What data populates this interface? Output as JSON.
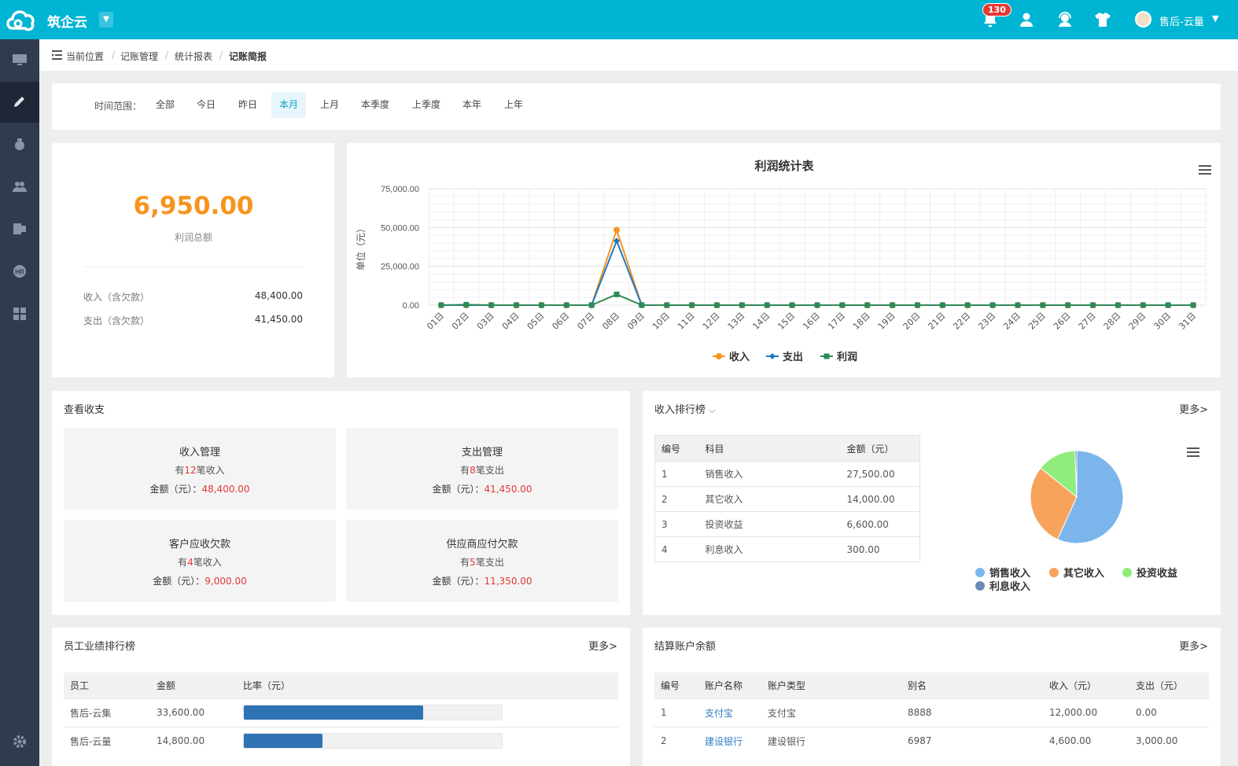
{
  "app": {
    "brand": "筑企云",
    "notif_count": "130",
    "user": "售后-云量"
  },
  "breadcrumb": {
    "prefix": "当前位置",
    "items": [
      "记账管理",
      "统计报表",
      "记账简报"
    ]
  },
  "filter": {
    "label": "时间范围：",
    "options": [
      "全部",
      "今日",
      "昨日",
      "本月",
      "上月",
      "本季度",
      "上季度",
      "本年",
      "上年"
    ],
    "active": "本月"
  },
  "summary": {
    "profit": "6,950.00",
    "profit_label": "利润总额",
    "income_label": "收入（含欠款）",
    "income": "48,400.00",
    "expense_label": "支出（含欠款）",
    "expense": "41,450.00"
  },
  "chart_data": {
    "type": "line",
    "title": "利润统计表",
    "ylabel": "单位（元）",
    "ylim": [
      0,
      75000
    ],
    "yticks": [
      "0.00",
      "25,000.00",
      "50,000.00",
      "75,000.00"
    ],
    "categories": [
      "01日",
      "02日",
      "03日",
      "04日",
      "05日",
      "06日",
      "07日",
      "08日",
      "09日",
      "10日",
      "11日",
      "12日",
      "13日",
      "14日",
      "15日",
      "16日",
      "17日",
      "18日",
      "19日",
      "20日",
      "21日",
      "22日",
      "23日",
      "24日",
      "25日",
      "26日",
      "27日",
      "28日",
      "29日",
      "30日",
      "31日"
    ],
    "series": [
      {
        "name": "收入",
        "color": "#f7941d",
        "marker": "circle",
        "values": [
          0,
          0,
          0,
          0,
          0,
          0,
          0,
          48400,
          0,
          0,
          0,
          0,
          0,
          0,
          0,
          0,
          0,
          0,
          0,
          0,
          0,
          0,
          0,
          0,
          0,
          0,
          0,
          0,
          0,
          0,
          0
        ]
      },
      {
        "name": "支出",
        "color": "#1f7ac2",
        "marker": "diamond",
        "values": [
          0,
          0,
          0,
          0,
          0,
          0,
          0,
          41450,
          0,
          0,
          0,
          0,
          0,
          0,
          0,
          0,
          0,
          0,
          0,
          0,
          0,
          0,
          0,
          0,
          0,
          0,
          0,
          0,
          0,
          0,
          0
        ]
      },
      {
        "name": "利润",
        "color": "#2e8b57",
        "marker": "square",
        "values": [
          0,
          300,
          0,
          0,
          0,
          0,
          0,
          6950,
          0,
          0,
          0,
          0,
          0,
          0,
          0,
          0,
          0,
          0,
          0,
          0,
          0,
          0,
          0,
          0,
          0,
          0,
          0,
          0,
          0,
          0,
          0
        ]
      }
    ],
    "legend": "bottom-center",
    "grid": true
  },
  "view": {
    "title": "查看收支",
    "tiles": [
      {
        "title": "收入管理",
        "pre": "有",
        "count": "12",
        "post": "笔收入",
        "amount_label": "金额（元）：",
        "amount": "48,400.00"
      },
      {
        "title": "支出管理",
        "pre": "有",
        "count": "8",
        "post": "笔支出",
        "amount_label": "金额（元）：",
        "amount": "41,450.00"
      },
      {
        "title": "客户应收欠款",
        "pre": "有",
        "count": "4",
        "post": "笔收入",
        "amount_label": "金额（元）：",
        "amount": "9,000.00"
      },
      {
        "title": "供应商应付欠款",
        "pre": "有",
        "count": "5",
        "post": "笔支出",
        "amount_label": "金额（元）：",
        "amount": "11,350.00"
      }
    ]
  },
  "income_rank": {
    "title": "收入排行榜",
    "more": "更多>",
    "headers": [
      "编号",
      "科目",
      "金额（元）"
    ],
    "rows": [
      [
        "1",
        "销售收入",
        "27,500.00"
      ],
      [
        "2",
        "其它收入",
        "14,000.00"
      ],
      [
        "3",
        "投资收益",
        "6,600.00"
      ],
      [
        "4",
        "利息收入",
        "300.00"
      ]
    ],
    "pie": [
      {
        "name": "销售收入",
        "value": 27500,
        "color": "#7cb5ec"
      },
      {
        "name": "其它收入",
        "value": 14000,
        "color": "#f7a35c"
      },
      {
        "name": "投资收益",
        "value": 6600,
        "color": "#90ed7d"
      },
      {
        "name": "利息收入",
        "value": 300,
        "color": "#6b8bb5"
      }
    ]
  },
  "staff": {
    "title": "员工业绩排行榜",
    "more": "更多>",
    "headers": [
      "员工",
      "金额",
      "比率（元）"
    ],
    "rows": [
      {
        "name": "售后-云集",
        "amount": "33,600.00",
        "ratio": 0.694
      },
      {
        "name": "售后-云量",
        "amount": "14,800.00",
        "ratio": 0.306
      }
    ]
  },
  "accounts": {
    "title": "结算账户余额",
    "more": "更多>",
    "headers": [
      "编号",
      "账户名称",
      "账户类型",
      "别名",
      "收入（元）",
      "支出（元）"
    ],
    "rows": [
      [
        "1",
        "支付宝",
        "支付宝",
        "8888",
        "12,000.00",
        "0.00"
      ],
      [
        "2",
        "建设银行",
        "建设银行",
        "6987",
        "4,600.00",
        "3,000.00"
      ]
    ]
  }
}
